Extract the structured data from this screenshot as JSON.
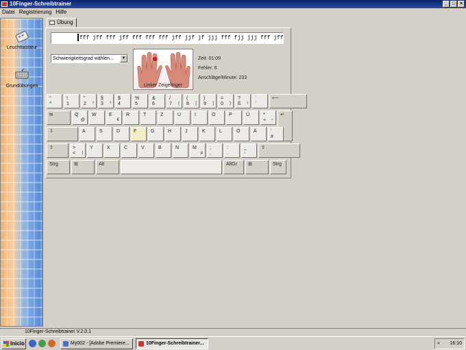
{
  "window": {
    "title": "10Finger-Schreibtrainer"
  },
  "menu": [
    "Datei",
    "Registrierung",
    "Hilfe"
  ],
  "sidebar": {
    "items": [
      {
        "label": "Leuchttastatur"
      },
      {
        "label": "Grundübungen"
      }
    ]
  },
  "tab": {
    "label": "Übung"
  },
  "exercise": {
    "text": "fff jff fff jff fff fff fff jff jjf jf jjj fff fjj jjj fff jff jjj fff fff fff fff jjj fff jff",
    "difficulty_placeholder": "Schwierigkeitsgrad wählen...",
    "finger_hint": "Linker Zeigefinger",
    "stats": {
      "time": "Zeit: 01:09",
      "errors": "Fehler: 6",
      "speed": "Anschläge/Minute: 233"
    }
  },
  "keyboard": {
    "rows": [
      [
        {
          "t": "°",
          "b": "^"
        },
        {
          "t": "!",
          "b": "1"
        },
        {
          "t": "\"",
          "b": "2",
          "a": "²"
        },
        {
          "t": "§",
          "b": "3",
          "a": "³"
        },
        {
          "t": "$",
          "b": "4"
        },
        {
          "t": "%",
          "b": "5"
        },
        {
          "t": "&",
          "b": "6"
        },
        {
          "t": "/",
          "b": "7",
          "a": "{"
        },
        {
          "t": "(",
          "b": "8",
          "a": "["
        },
        {
          "t": ")",
          "b": "9",
          "a": "]"
        },
        {
          "t": "=",
          "b": "0",
          "a": "}"
        },
        {
          "t": "?",
          "b": "ß",
          "a": "\\"
        },
        {
          "t": "`",
          "b": "´"
        },
        {
          "t": "⟵",
          "b": ""
        }
      ],
      [
        {
          "t": "⭾",
          "b": ""
        },
        {
          "t": "Q",
          "b": "",
          "a": "@"
        },
        {
          "t": "W",
          "b": ""
        },
        {
          "t": "E",
          "b": "",
          "a": "€"
        },
        {
          "t": "R",
          "b": ""
        },
        {
          "t": "T",
          "b": ""
        },
        {
          "t": "Z",
          "b": ""
        },
        {
          "t": "U",
          "b": ""
        },
        {
          "t": "I",
          "b": ""
        },
        {
          "t": "O",
          "b": ""
        },
        {
          "t": "P",
          "b": ""
        },
        {
          "t": "Ü",
          "b": ""
        },
        {
          "t": "*",
          "b": "+",
          "a": "~"
        },
        {
          "t": "↵",
          "b": ""
        }
      ],
      [
        {
          "t": "⇩",
          "b": ""
        },
        {
          "t": "A",
          "b": ""
        },
        {
          "t": "S",
          "b": ""
        },
        {
          "t": "D",
          "b": ""
        },
        {
          "t": "F",
          "b": ""
        },
        {
          "t": "G",
          "b": ""
        },
        {
          "t": "H",
          "b": ""
        },
        {
          "t": "J",
          "b": ""
        },
        {
          "t": "K",
          "b": ""
        },
        {
          "t": "L",
          "b": ""
        },
        {
          "t": "Ö",
          "b": ""
        },
        {
          "t": "Ä",
          "b": ""
        },
        {
          "t": "'",
          "b": "#"
        }
      ],
      [
        {
          "t": "⇧",
          "b": ""
        },
        {
          "t": ">",
          "b": "<",
          "a": "|"
        },
        {
          "t": "Y",
          "b": ""
        },
        {
          "t": "X",
          "b": ""
        },
        {
          "t": "C",
          "b": ""
        },
        {
          "t": "V",
          "b": ""
        },
        {
          "t": "B",
          "b": ""
        },
        {
          "t": "N",
          "b": ""
        },
        {
          "t": "M",
          "b": "",
          "a": "µ"
        },
        {
          "t": ";",
          "b": ","
        },
        {
          "t": ":",
          "b": "."
        },
        {
          "t": "_",
          "b": "-"
        },
        {
          "t": "⇧",
          "b": ""
        }
      ],
      [
        {
          "t": "Strg",
          "b": ""
        },
        {
          "t": "⊞",
          "b": ""
        },
        {
          "t": "Alt",
          "b": ""
        },
        {
          "t": "",
          "b": ""
        },
        {
          "t": "AltGr",
          "b": ""
        },
        {
          "t": "⊞",
          "b": ""
        },
        {
          "t": "Strg",
          "b": ""
        }
      ]
    ]
  },
  "statusbar": {
    "text": "10Finger-Schreibtrainer V.2.0.1"
  },
  "taskbar": {
    "start": "Inicio",
    "tasks": [
      {
        "label": "My002 - [Adobe Premiere..."
      },
      {
        "label": "10Finger-Schreibtrainer..."
      }
    ],
    "clock": "16:10"
  },
  "colors": {
    "title_bar": "#0a246a",
    "highlight_key": "#f3eec6",
    "window": "#d4d0c8"
  }
}
